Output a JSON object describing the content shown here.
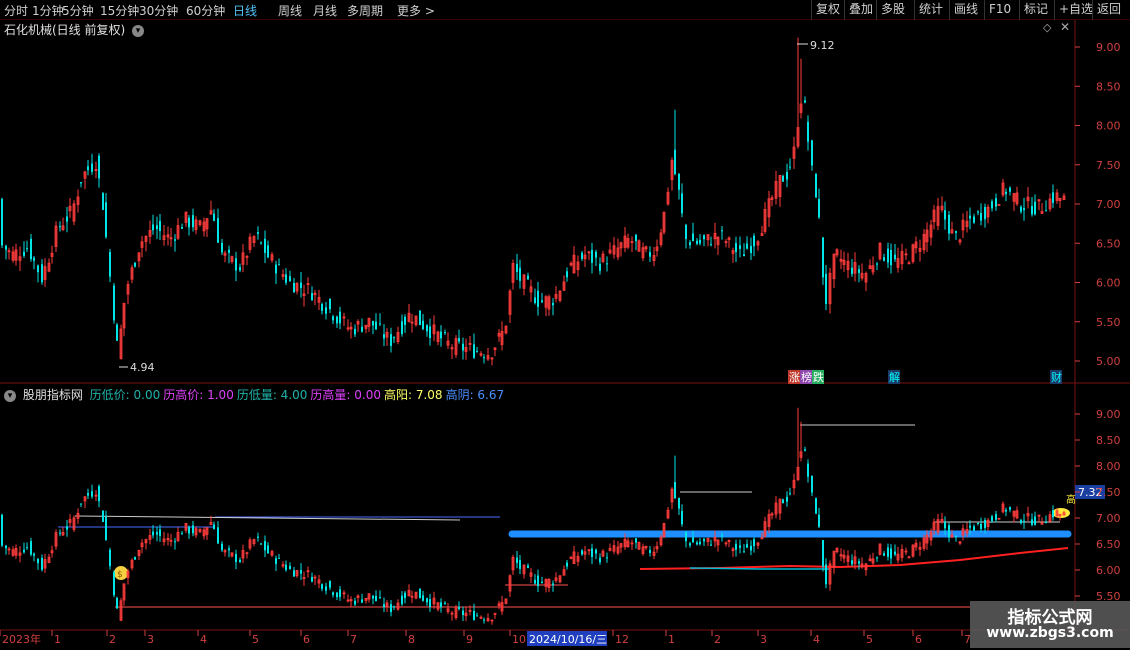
{
  "toolbar": {
    "left": [
      "分时",
      "1分钟",
      "5分钟",
      "15分钟",
      "30分钟",
      "60分钟",
      "日线",
      "周线",
      "月线",
      "多周期",
      "更多 >"
    ],
    "active_index": 6,
    "right": [
      "复权",
      "叠加",
      "多股",
      "统计",
      "画线",
      "F10",
      "标记",
      "+自选",
      "返回"
    ]
  },
  "main_panel": {
    "title": "石化机械(日线 前复权)",
    "high_label": "9.12",
    "low_label": "4.94",
    "events": [
      {
        "text": "涨",
        "color": "#ffffff",
        "bg": "#c0392b"
      },
      {
        "text": "榜",
        "color": "#ffffff",
        "bg": "#8e44ad"
      },
      {
        "text": "跌",
        "color": "#ffffff",
        "bg": "#27ae60"
      },
      {
        "text": "解",
        "color": "#00ffff",
        "bg": "#1a3a6a"
      },
      {
        "text": "财",
        "color": "#00ffff",
        "bg": "#1a3a6a"
      }
    ],
    "price_axis": [
      "9.00",
      "8.50",
      "8.00",
      "7.50",
      "7.00",
      "6.50",
      "6.00",
      "5.50",
      "5.00"
    ]
  },
  "indicator_panel": {
    "name": "股朋指标网",
    "fields": [
      {
        "label": "历低价:",
        "value": "0.00",
        "color": "#20b2aa"
      },
      {
        "label": "历高价:",
        "value": "1.00",
        "color": "#e040fb"
      },
      {
        "label": "历低量:",
        "value": "4.00",
        "color": "#20b2aa"
      },
      {
        "label": "历高量:",
        "value": "0.00",
        "color": "#e040fb"
      },
      {
        "label": "高阳:",
        "value": "7.08",
        "color": "#ffff66"
      },
      {
        "label": "高阴:",
        "value": "6.67",
        "color": "#4a90ff"
      }
    ],
    "price_axis": [
      "9.00",
      "8.50",
      "8.00",
      "7.50",
      "7.00",
      "6.50",
      "6.00",
      "5.50"
    ],
    "current_price_tag": "7.32",
    "side_char": "高"
  },
  "time_axis": {
    "labels": [
      "2023年",
      "1",
      "2",
      "3",
      "4",
      "5",
      "6",
      "7",
      "8",
      "9",
      "10",
      "2024/10/16/三",
      "12",
      "1",
      "2",
      "3",
      "4",
      "5",
      "6",
      "7"
    ],
    "cursor_label": "2024/10/16/三"
  },
  "watermark": {
    "line1": "指标公式网",
    "line2": "www.zbgs3.com"
  },
  "colors": {
    "up": "#ff3c3c",
    "down": "#00e5e5",
    "thick_line": "#1e8fff",
    "support_line": "#ff2020",
    "axis_text": "#d04040"
  }
}
